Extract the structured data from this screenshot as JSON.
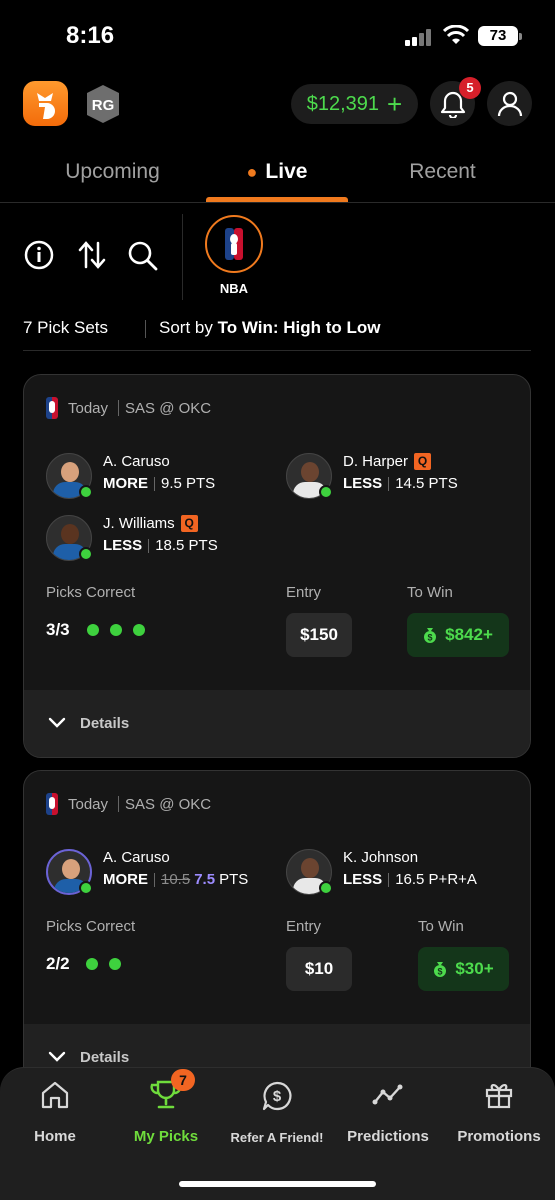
{
  "status_bar": {
    "time": "8:16",
    "battery": "73"
  },
  "header": {
    "rg_label": "RG",
    "balance": "$12,391",
    "balance_plus": "+",
    "notifications_count": "5"
  },
  "tabs": [
    {
      "label": "Upcoming"
    },
    {
      "label": "Live",
      "active": true
    },
    {
      "label": "Recent"
    }
  ],
  "filters": {
    "league_label": "NBA"
  },
  "sort_row": {
    "count": "7 Pick Sets",
    "sort_prefix": "Sort by",
    "sort_value": "To Win: High to Low"
  },
  "cards": [
    {
      "day": "Today",
      "matchup": "SAS @ OKC",
      "picks": [
        {
          "name": "A. Caruso",
          "direction": "MORE",
          "line": "9.5 PTS",
          "injury": ""
        },
        {
          "name": "D. Harper",
          "direction": "LESS",
          "line": "14.5 PTS",
          "injury": "Q"
        },
        {
          "name": "J. Williams",
          "direction": "LESS",
          "line": "18.5 PTS",
          "injury": "Q"
        }
      ],
      "picks_correct_label": "Picks Correct",
      "picks_correct": "3/3",
      "entry_label": "Entry",
      "entry": "$150",
      "to_win_label": "To Win",
      "to_win": "$842+",
      "details_label": "Details"
    },
    {
      "day": "Today",
      "matchup": "SAS @ OKC",
      "picks": [
        {
          "name": "A. Caruso",
          "direction": "MORE",
          "old_line": "10.5",
          "new_line": "7.5",
          "unit": "PTS"
        },
        {
          "name": "K. Johnson",
          "direction": "LESS",
          "line": "16.5 P+R+A"
        }
      ],
      "picks_correct_label": "Picks Correct",
      "picks_correct": "2/2",
      "entry_label": "Entry",
      "entry": "$10",
      "to_win_label": "To Win",
      "to_win": "$30+",
      "details_label": "Details"
    }
  ],
  "bottom_nav": [
    {
      "label": "Home",
      "icon": "home-icon"
    },
    {
      "label": "My Picks",
      "icon": "trophy-icon",
      "active": true,
      "badge": "7"
    },
    {
      "label": "Refer A Friend!",
      "icon": "dollar-chat-icon"
    },
    {
      "label": "Predictions",
      "icon": "trend-line-icon"
    },
    {
      "label": "Promotions",
      "icon": "gift-icon"
    }
  ],
  "colors": {
    "accent_orange": "#f07a1e",
    "money_green": "#4ddb4d",
    "background": "#000000",
    "card": "#161616"
  }
}
